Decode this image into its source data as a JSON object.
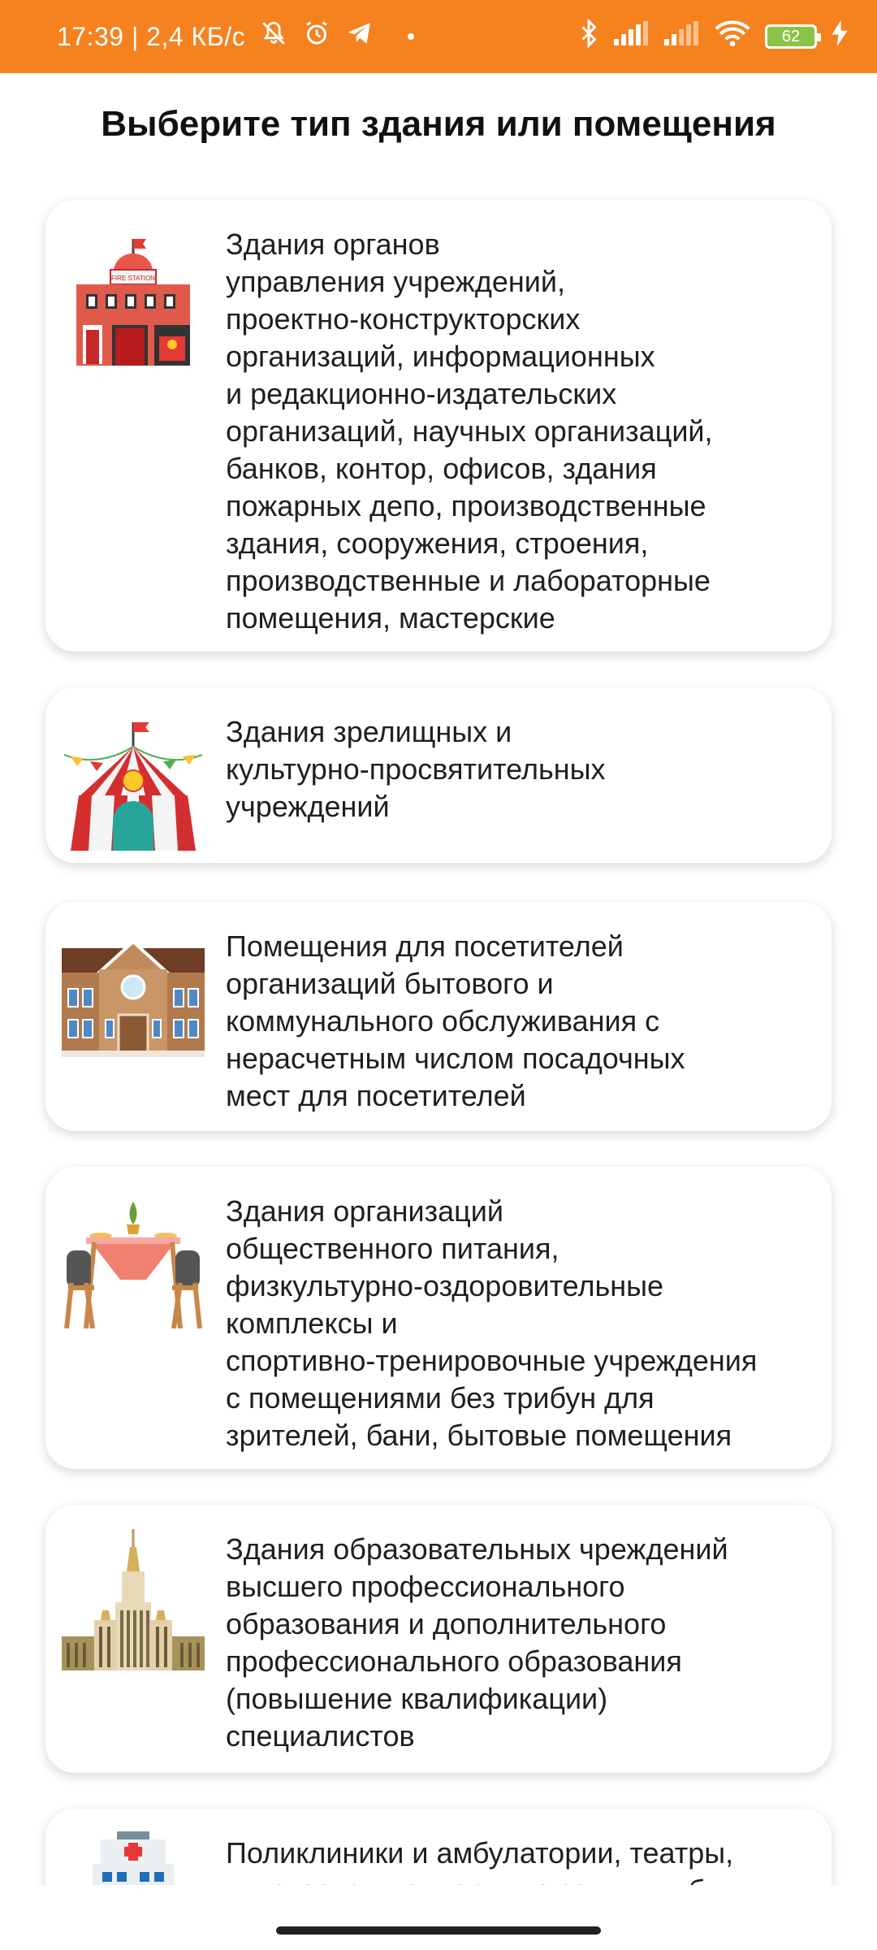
{
  "status_bar": {
    "left_text": "17:39 | 2,4 КБ/с",
    "battery": "62"
  },
  "page": {
    "title": "Выберите тип здания или помещения"
  },
  "items": [
    {
      "icon": "fire-station-icon",
      "label": "Здания органов\nуправления учреждений,\nпроектно-конструкторских\nорганизаций, информационных\nи редакционно-издательских\nорганизаций, научных организаций,\nбанков, контор, офисов, здания\nпожарных депо, производственные\nздания, сооружения, строения,\nпроизводственные и лабораторные\nпомещения, мастерские",
      "icon_text": "FIRE STATION"
    },
    {
      "icon": "circus-tent-icon",
      "label": "Здания зрелищных и\nкультурно-просвятительных\nучреждений"
    },
    {
      "icon": "service-building-icon",
      "label": "Помещения для посетителей\nорганизаций бытового и\nкоммунального обслуживания с\nнерасчетным числом посадочных\nмест для посетителей"
    },
    {
      "icon": "dining-table-icon",
      "label": "Здания организаций\nобщественного питания,\nфизкультурно-оздоровительные\nкомплексы и\nспортивно-тренировочные учреждения\nс помещениями без трибун для\nзрителей, бани, бытовые помещения"
    },
    {
      "icon": "university-building-icon",
      "label": "Здания образовательных чреждений\nвысшего профессионального\nобразования и дополнительного\nпрофессионального образования\n(повышение квалификации)\nспециалистов"
    },
    {
      "icon": "hospital-icon",
      "label": "Поликлиники и амбулатории, театры,\nкинотеатры концертные залы, клубы"
    }
  ]
}
